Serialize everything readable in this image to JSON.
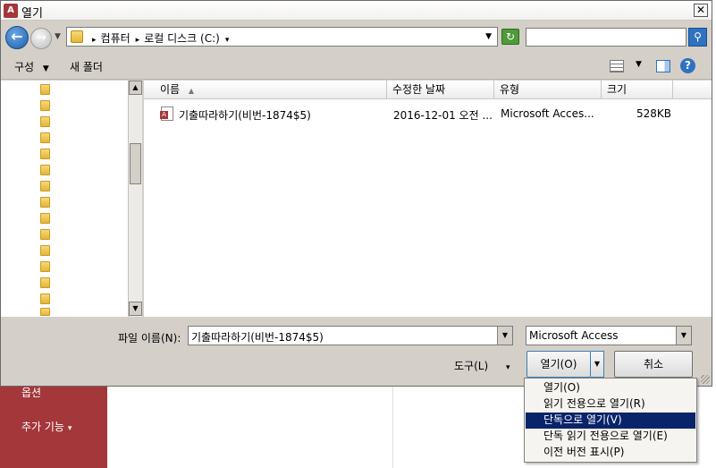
{
  "background": {
    "sidebar_items": [
      "옵션",
      "추가 기능"
    ],
    "more_arrow": "▾"
  },
  "dialog": {
    "title": "열기",
    "app_icon": "A",
    "close_glyph": "✕"
  },
  "navigation": {
    "back_glyph": "←",
    "forward_glyph": "→",
    "breadcrumb": [
      "컴퓨터",
      "로컬 디스크 (C:)"
    ],
    "refresh_glyph": "↻",
    "search_placeholder": "",
    "search_glyph": "⚲"
  },
  "toolbar": {
    "organize_label": "구성",
    "new_folder_label": "새 폴더",
    "help_glyph": "?"
  },
  "file_list": {
    "columns": [
      "이름",
      "수정한 날짜",
      "유형",
      "크기"
    ],
    "sort_arrow": "▲",
    "rows": [
      {
        "name": "기출따라하기(비번-1874$5)",
        "modified": "2016-12-01 오전 ...",
        "type": "Microsoft Acces...",
        "size": "528KB"
      }
    ]
  },
  "bottom": {
    "filename_label": "파일 이름(N):",
    "filename_value": "기출따라하기(비번-1874$5)",
    "filetype_value": "Microsoft Access",
    "tools_label": "도구(L)",
    "open_label": "열기(O)",
    "cancel_label": "취소"
  },
  "open_menu": {
    "items": [
      "열기(O)",
      "읽기 전용으로 열기(R)",
      "단독으로 열기(V)",
      "단독 읽기 전용으로 열기(E)",
      "이전 버전 표시(P)"
    ],
    "selected_index": 2
  },
  "colors": {
    "accent": "#0a246a",
    "brand": "#a4373a"
  }
}
